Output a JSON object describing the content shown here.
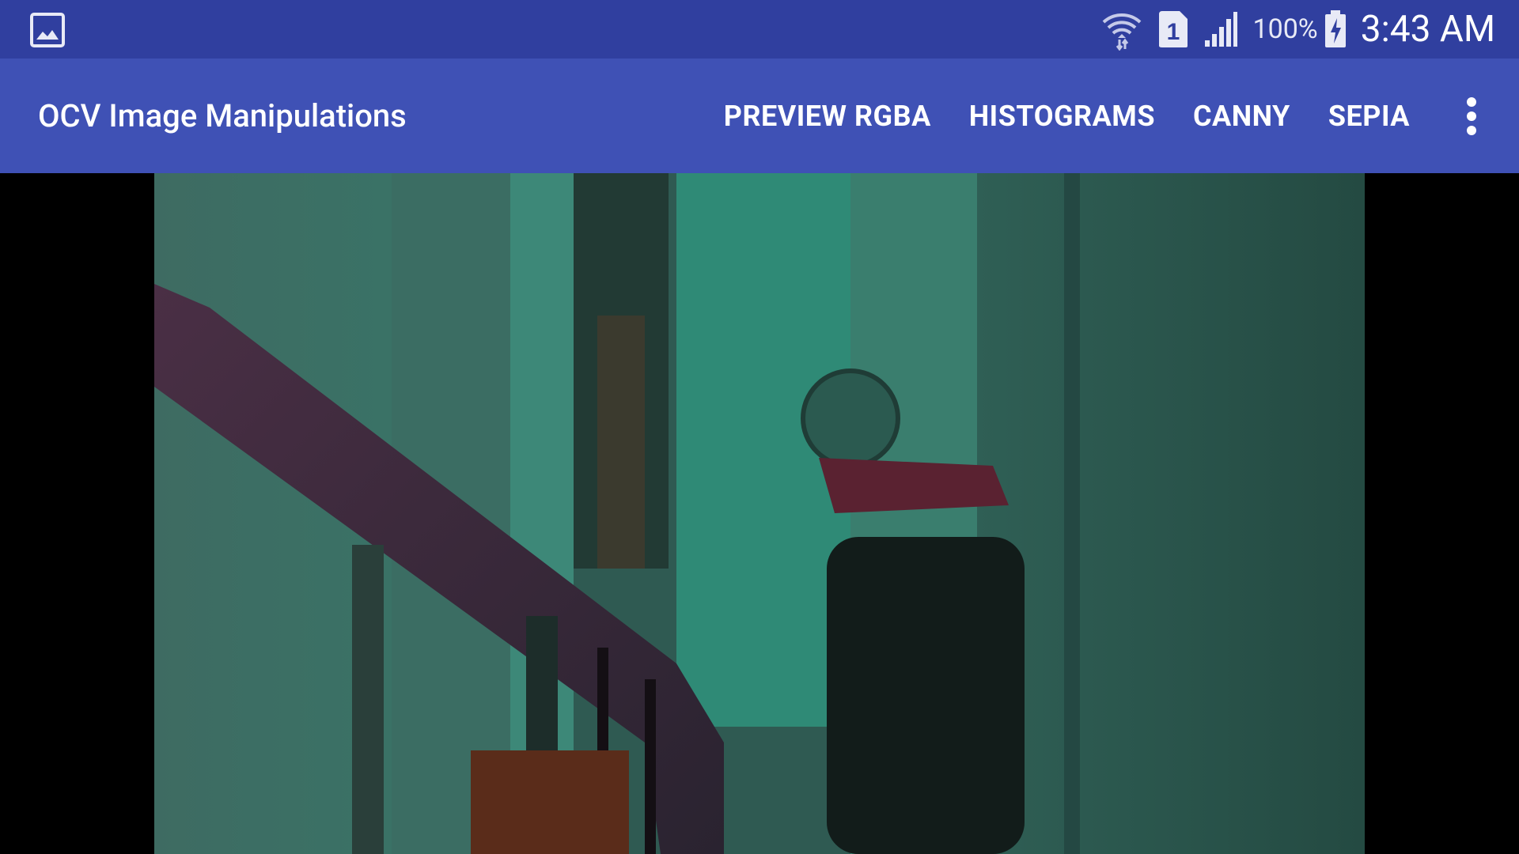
{
  "status_bar": {
    "left_icons": [
      "gallery-icon"
    ],
    "right_icons": [
      "wifi-icon",
      "sim-1-icon",
      "signal-icon",
      "battery-charging-icon"
    ],
    "battery_percent": "100%",
    "clock": "3:43 AM",
    "color": "#303F9F"
  },
  "app_bar": {
    "title": "OCV Image Manipulations",
    "actions": {
      "preview_rgba": "PREVIEW RGBA",
      "histograms": "HISTOGRAMS",
      "canny": "CANNY",
      "sepia": "SEPIA"
    },
    "overflow_icon": "more-vert-icon",
    "color": "#3F51B5"
  },
  "camera_preview": {
    "description_icon": "camera-frame"
  }
}
